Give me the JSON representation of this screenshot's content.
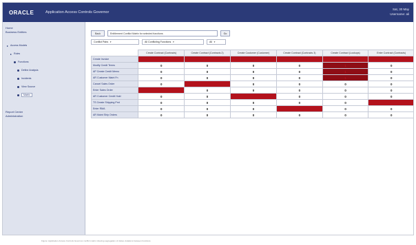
{
  "header": {
    "brand": "ORACLE",
    "app_title": "Application Access Controls Governor",
    "right_line1": "Sat, 30 May",
    "right_line2": "Username: ali"
  },
  "sidebar": {
    "top_line1": "Home",
    "top_line2": "Business Entities",
    "tree": [
      {
        "label": "Access Models",
        "level": 0,
        "kind": "arrow",
        "selected": false
      },
      {
        "label": "Roles",
        "level": 1,
        "kind": "arrow",
        "selected": false
      },
      {
        "label": "Functions",
        "level": 2,
        "kind": "dot",
        "selected": false
      },
      {
        "label": "Define Analysis",
        "level": 3,
        "kind": "dot",
        "selected": false
      },
      {
        "label": "Incidents",
        "level": 3,
        "kind": "dot",
        "selected": false
      },
      {
        "label": "View Source",
        "level": 3,
        "kind": "dot",
        "selected": false
      },
      {
        "label": "Matrix",
        "level": 3,
        "kind": "dot",
        "selected": true
      }
    ],
    "links": [
      "Report Center",
      "Administration"
    ]
  },
  "toolbar": {
    "back_label": "Back",
    "path_value": "Entitlement Conflict Matrix for selected functions",
    "go_label": "Go"
  },
  "filters": {
    "view": "Conflict Pairs",
    "group": "All Conflicting Functions",
    "scope": "All"
  },
  "matrix": {
    "columns": [
      "Create Contract (Contracts)",
      "Create Contract (Contracts 2)",
      "Create Customer (Customer)",
      "Create Contract (Contracts 3)",
      "Create Contract (Lookups)",
      "Enter Contract (Contracts)"
    ],
    "rows": [
      {
        "label": "Create Invoice",
        "cells": [
          1,
          1,
          1,
          1,
          1,
          1
        ]
      },
      {
        "label": "Modify Credit Terms",
        "cells": [
          0,
          0,
          0,
          0,
          1,
          0
        ]
      },
      {
        "label": "AP Create Credit Memo",
        "cells": [
          0,
          0,
          0,
          0,
          1,
          0
        ]
      },
      {
        "label": "AR Customer Maint Fn",
        "cells": [
          0,
          0,
          0,
          0,
          1,
          0
        ]
      },
      {
        "label": "Cancel Sales Order",
        "cells": [
          0,
          1,
          0,
          0,
          0,
          0
        ]
      },
      {
        "label": "Enter Sales Order",
        "cells": [
          1,
          0,
          0,
          0,
          0,
          0
        ]
      },
      {
        "label": "AR Customer Credit Hold",
        "cells": [
          0,
          0,
          1,
          0,
          0,
          0
        ]
      },
      {
        "label": "TS Create Shipping Pmt",
        "cells": [
          0,
          0,
          0,
          0,
          0,
          1
        ]
      },
      {
        "label": "Enter RMA",
        "cells": [
          0,
          0,
          0,
          1,
          0,
          0
        ]
      },
      {
        "label": "AR Maint Ship Orders",
        "cells": [
          0,
          0,
          0,
          0,
          0,
          0
        ]
      }
    ]
  },
  "colors": {
    "header_bg": "#2b3a78",
    "sidebar_bg": "#dfe3ee",
    "conflict": "#b3121c"
  },
  "footnote": "Figure: Application Access Controls Governor conflict matrix showing segregation of duties violations between functions."
}
